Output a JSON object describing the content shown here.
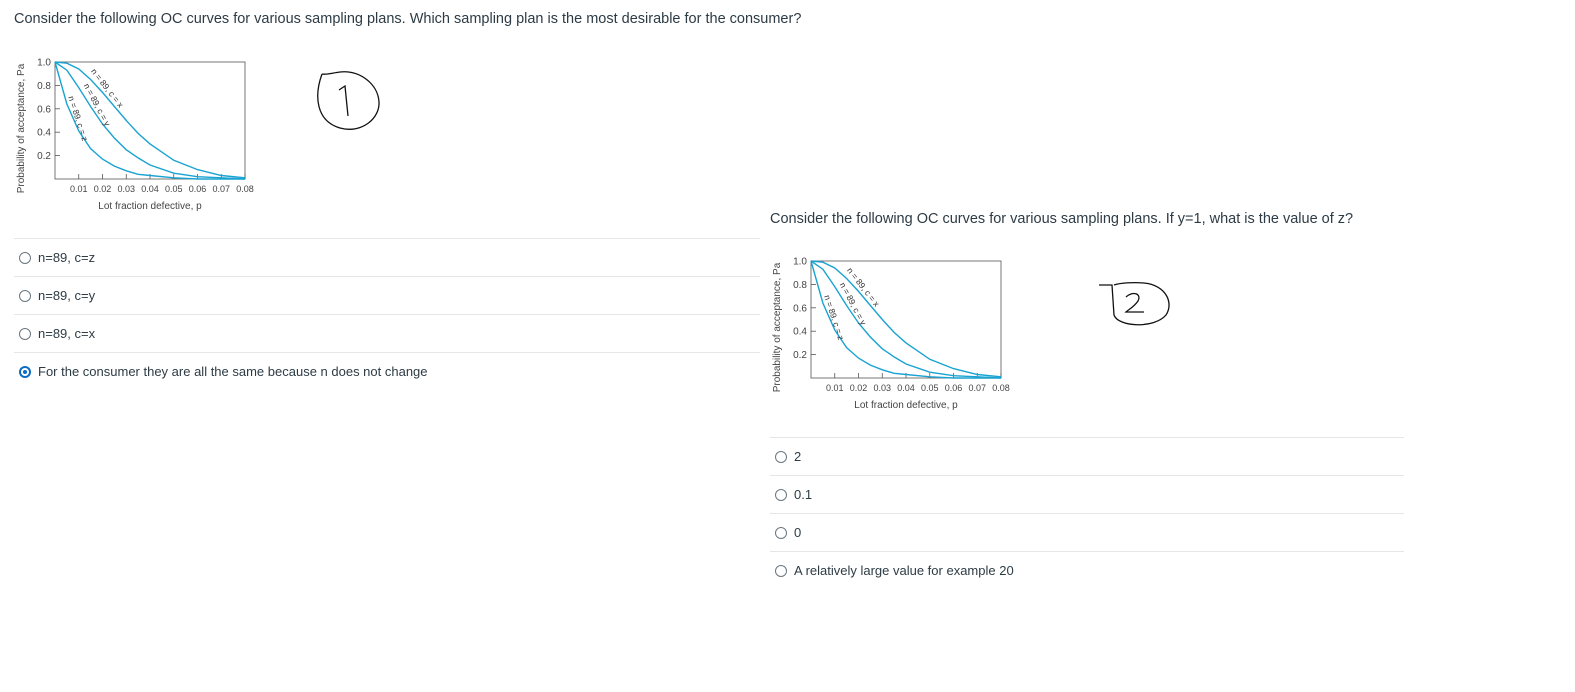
{
  "question1": {
    "text": "Consider the following OC curves for various sampling plans. Which sampling plan is the most desirable for the consumer?",
    "answers": [
      {
        "label": "n=89, c=z",
        "selected": false
      },
      {
        "label": "n=89, c=y",
        "selected": false
      },
      {
        "label": "n=89, c=x",
        "selected": false
      },
      {
        "label": "For the consumer they are all the same because n does not change",
        "selected": true
      }
    ],
    "annotation": "1"
  },
  "question2": {
    "text": "Consider the following OC curves for various sampling plans. If y=1, what is the value of z?",
    "answers": [
      {
        "label": "2",
        "selected": false
      },
      {
        "label": "0.1",
        "selected": false
      },
      {
        "label": "0",
        "selected": false
      },
      {
        "label": "A relatively large value for example 20",
        "selected": false
      }
    ],
    "annotation": "2"
  },
  "chart_data": [
    {
      "type": "line",
      "ylabel": "Probability of acceptance, Pa",
      "xlabel": "Lot fraction defective, p",
      "x_ticks": [
        "0.01",
        "0.02",
        "0.03",
        "0.04",
        "0.05",
        "0.06",
        "0.07",
        "0.08"
      ],
      "y_ticks": [
        "0.2",
        "0.4",
        "0.6",
        "0.8",
        "1.0"
      ],
      "xlim": [
        0,
        0.08
      ],
      "ylim": [
        0,
        1.0
      ],
      "line_color": "#1aa3d1",
      "series": [
        {
          "name": "n = 89, c = x",
          "x": [
            0,
            0.005,
            0.01,
            0.015,
            0.02,
            0.025,
            0.03,
            0.035,
            0.04,
            0.05,
            0.06,
            0.07,
            0.08
          ],
          "y": [
            1.0,
            0.99,
            0.94,
            0.85,
            0.74,
            0.62,
            0.5,
            0.39,
            0.3,
            0.16,
            0.08,
            0.03,
            0.01
          ]
        },
        {
          "name": "n = 89, c = y",
          "x": [
            0,
            0.005,
            0.01,
            0.015,
            0.02,
            0.025,
            0.03,
            0.035,
            0.04,
            0.05,
            0.06,
            0.07,
            0.08
          ],
          "y": [
            1.0,
            0.93,
            0.78,
            0.62,
            0.47,
            0.35,
            0.25,
            0.18,
            0.12,
            0.05,
            0.02,
            0.01,
            0.0
          ]
        },
        {
          "name": "n = 89, c = z",
          "x": [
            0,
            0.005,
            0.01,
            0.015,
            0.02,
            0.025,
            0.03,
            0.035,
            0.04,
            0.05,
            0.06,
            0.07,
            0.08
          ],
          "y": [
            1.0,
            0.64,
            0.41,
            0.26,
            0.17,
            0.11,
            0.07,
            0.04,
            0.03,
            0.01,
            0.0,
            0.0,
            0.0
          ]
        }
      ]
    },
    {
      "type": "line",
      "ylabel": "Probability of acceptance, Pa",
      "xlabel": "Lot fraction defective, p",
      "x_ticks": [
        "0.01",
        "0.02",
        "0.03",
        "0.04",
        "0.05",
        "0.06",
        "0.07",
        "0.08"
      ],
      "y_ticks": [
        "0.2",
        "0.4",
        "0.6",
        "0.8",
        "1.0"
      ],
      "xlim": [
        0,
        0.08
      ],
      "ylim": [
        0,
        1.0
      ],
      "line_color": "#1aa3d1",
      "series": [
        {
          "name": "n = 89, c = x",
          "x": [
            0,
            0.005,
            0.01,
            0.015,
            0.02,
            0.025,
            0.03,
            0.035,
            0.04,
            0.05,
            0.06,
            0.07,
            0.08
          ],
          "y": [
            1.0,
            0.99,
            0.94,
            0.85,
            0.74,
            0.62,
            0.5,
            0.39,
            0.3,
            0.16,
            0.08,
            0.03,
            0.01
          ]
        },
        {
          "name": "n = 89, c = y",
          "x": [
            0,
            0.005,
            0.01,
            0.015,
            0.02,
            0.025,
            0.03,
            0.035,
            0.04,
            0.05,
            0.06,
            0.07,
            0.08
          ],
          "y": [
            1.0,
            0.93,
            0.78,
            0.62,
            0.47,
            0.35,
            0.25,
            0.18,
            0.12,
            0.05,
            0.02,
            0.01,
            0.0
          ]
        },
        {
          "name": "n = 89, c = z",
          "x": [
            0,
            0.005,
            0.01,
            0.015,
            0.02,
            0.025,
            0.03,
            0.035,
            0.04,
            0.05,
            0.06,
            0.07,
            0.08
          ],
          "y": [
            1.0,
            0.64,
            0.41,
            0.26,
            0.17,
            0.11,
            0.07,
            0.04,
            0.03,
            0.01,
            0.0,
            0.0,
            0.0
          ]
        }
      ]
    }
  ]
}
